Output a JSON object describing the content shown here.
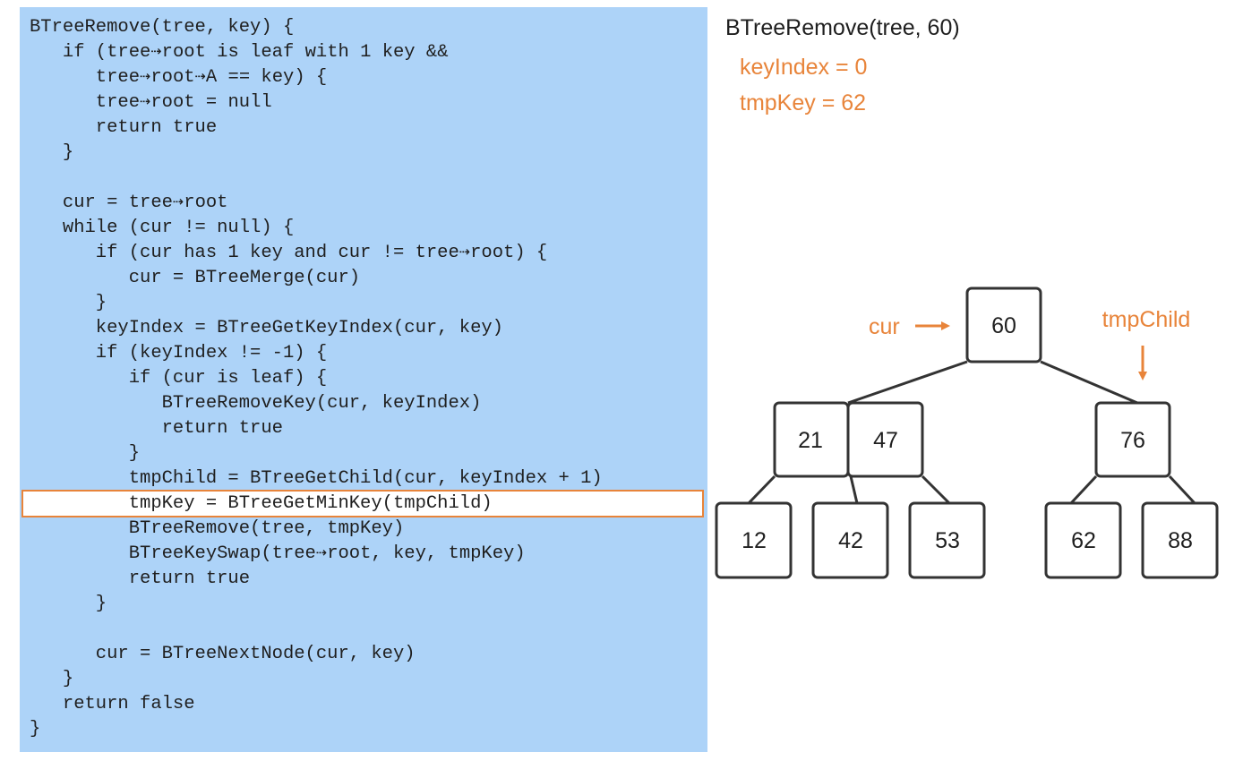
{
  "code": {
    "lines": [
      "BTreeRemove(tree, key) {",
      "   if (tree⇢root is leaf with 1 key &&",
      "      tree⇢root⇢A == key) {",
      "      tree⇢root = null",
      "      return true",
      "   }",
      "",
      "   cur = tree⇢root",
      "   while (cur != null) {",
      "      if (cur has 1 key and cur != tree⇢root) {",
      "         cur = BTreeMerge(cur)",
      "      }",
      "      keyIndex = BTreeGetKeyIndex(cur, key)",
      "      if (keyIndex != -1) {",
      "         if (cur is leaf) {",
      "            BTreeRemoveKey(cur, keyIndex)",
      "            return true",
      "         }",
      "         tmpChild = BTreeGetChild(cur, keyIndex + 1)",
      "         tmpKey = BTreeGetMinKey(tmpChild)",
      "         BTreeRemove(tree, tmpKey)",
      "         BTreeKeySwap(tree⇢root, key, tmpKey)",
      "         return true",
      "      }",
      "",
      "      cur = BTreeNextNode(cur, key)",
      "   }",
      "   return false",
      "}"
    ],
    "highlighted_line": 19,
    "highlight_color": "#e8843a",
    "panel_color": "#add3f8"
  },
  "state": {
    "call": "BTreeRemove(tree, 60)",
    "variables": [
      "keyIndex = 0",
      "tmpKey = 62"
    ],
    "accent_color": "#e8843a"
  },
  "tree": {
    "root": {
      "keys": [
        "60"
      ]
    },
    "level1": [
      {
        "keys": [
          "21",
          "47"
        ]
      },
      {
        "keys": [
          "76"
        ]
      }
    ],
    "leaves": [
      {
        "keys": [
          "12"
        ]
      },
      {
        "keys": [
          "42"
        ]
      },
      {
        "keys": [
          "53"
        ]
      },
      {
        "keys": [
          "62"
        ]
      },
      {
        "keys": [
          "88"
        ]
      }
    ],
    "pointers": {
      "cur": "cur",
      "tmpChild": "tmpChild"
    }
  }
}
